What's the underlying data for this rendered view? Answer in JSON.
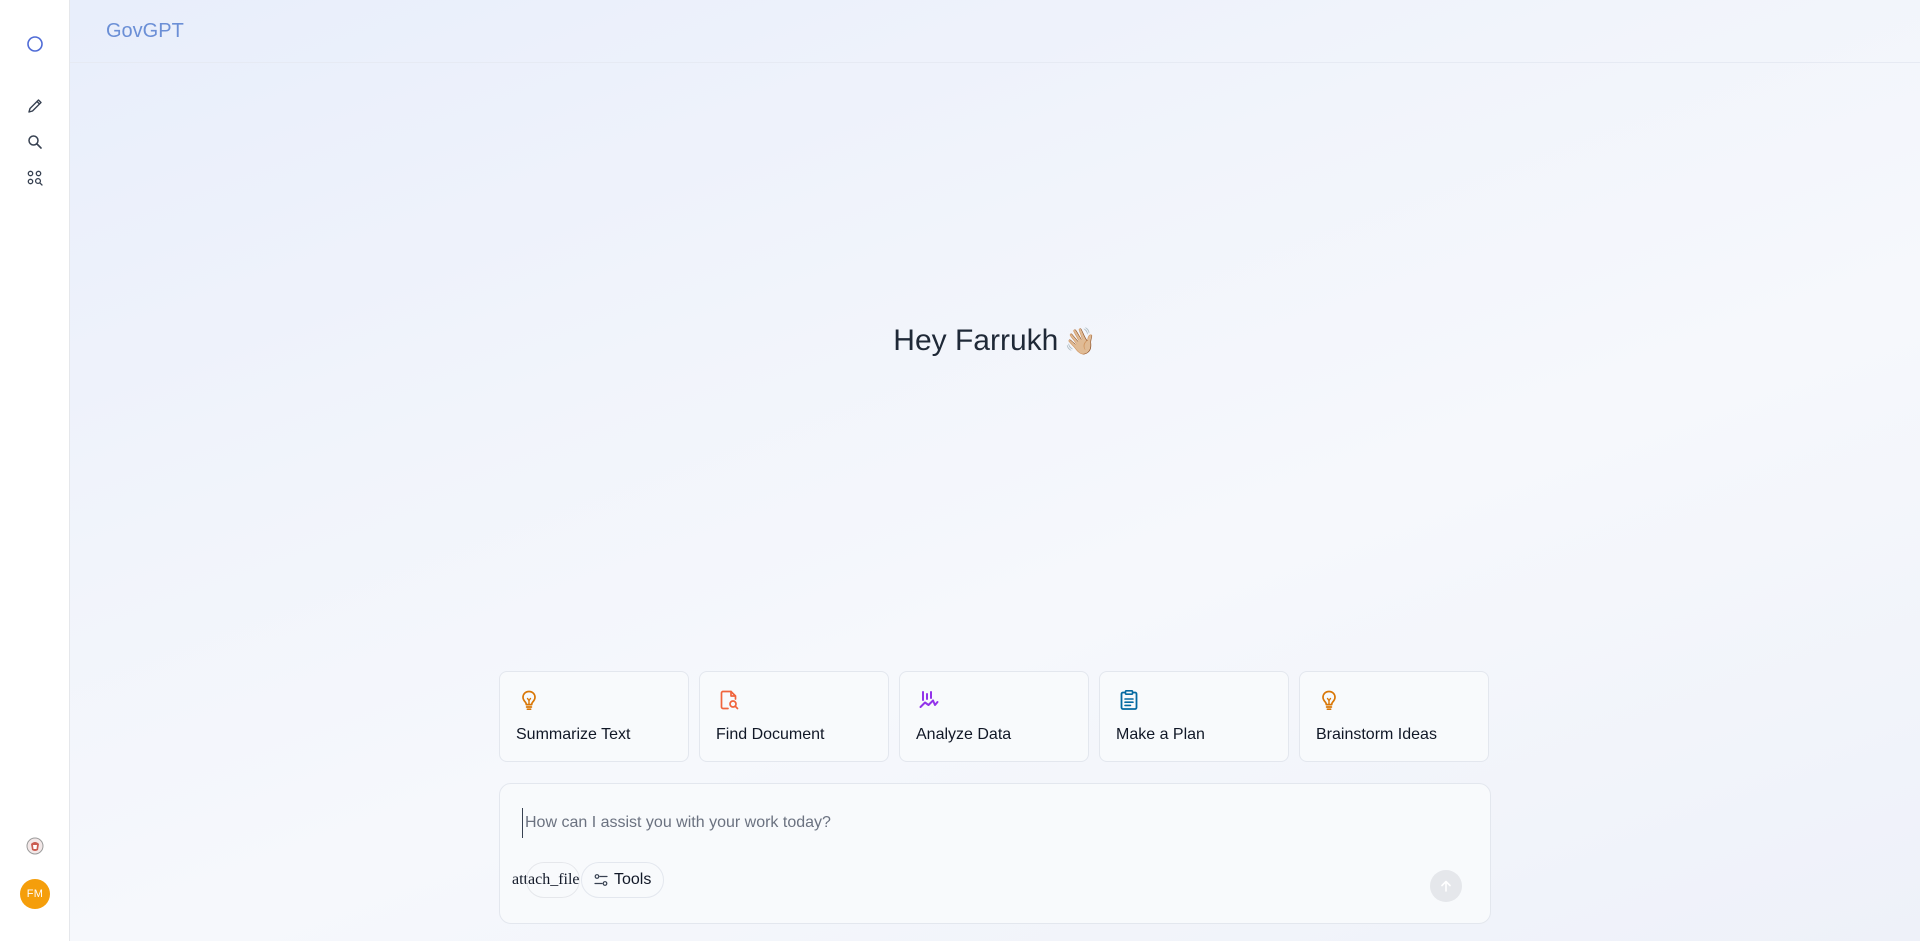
{
  "app": {
    "brand": "GovGPT"
  },
  "sidebar": {
    "items": [
      {
        "name": "home",
        "icon": "circle-icon"
      },
      {
        "name": "new-chat",
        "icon": "pencil-icon"
      },
      {
        "name": "search",
        "icon": "search-icon"
      },
      {
        "name": "apps",
        "icon": "apps-search-icon"
      }
    ],
    "avatar_initials": "FM",
    "avatar_color": "#f59e0b"
  },
  "main": {
    "greeting": "Hey Farrukh",
    "greeting_emoji": "👋🏼"
  },
  "suggestions": [
    {
      "label": "Summarize Text",
      "icon": "lightbulb-icon",
      "color": "#d97706"
    },
    {
      "label": "Find Document",
      "icon": "file-search-icon",
      "color": "#f0643c"
    },
    {
      "label": "Analyze Data",
      "icon": "chart-icon",
      "color": "#9333ea"
    },
    {
      "label": "Make a Plan",
      "icon": "clipboard-icon",
      "color": "#0369a1"
    },
    {
      "label": "Brainstorm Ideas",
      "icon": "lightbulb-icon",
      "color": "#d97706"
    }
  ],
  "composer": {
    "placeholder": "How can I assist you with your work today?",
    "value": "",
    "attach_label": "attach_file",
    "tools_label": "Tools"
  },
  "colors": {
    "brand": "#6b8fd6",
    "sidebar_icon": "#374151",
    "home_icon": "#4f6bd6"
  }
}
